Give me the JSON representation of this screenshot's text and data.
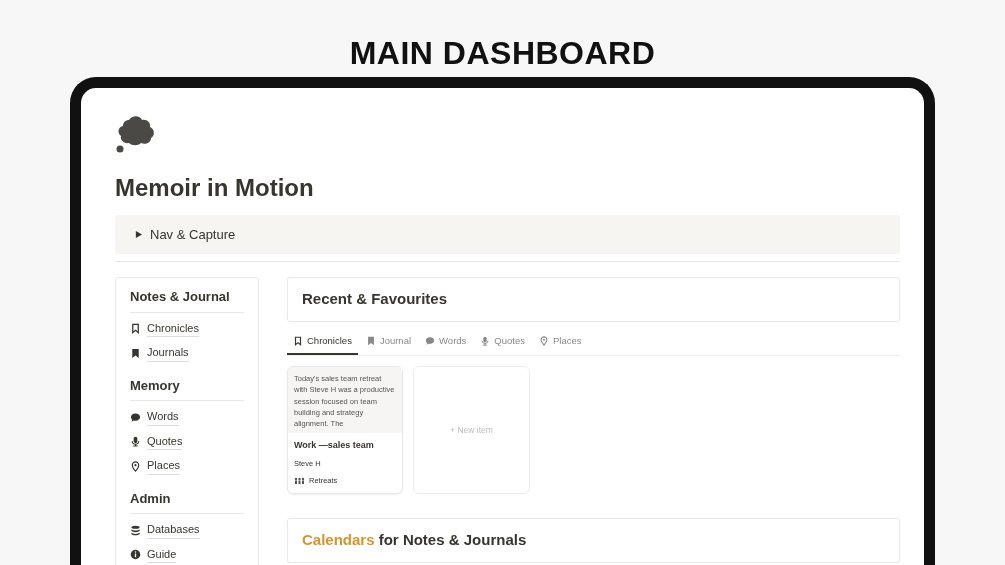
{
  "heading": "MAIN DASHBOARD",
  "page": {
    "title": "Memoir in Motion",
    "toggle": {
      "label": "Nav & Capture",
      "expanded": false
    }
  },
  "sidebar": {
    "sections": [
      {
        "title": "Notes & Journal",
        "items": [
          {
            "label": "Chronicles",
            "kind": "outline"
          },
          {
            "label": "Journals",
            "kind": "bookmark"
          }
        ]
      },
      {
        "title": "Memory",
        "items": [
          {
            "label": "Words",
            "kind": "bubble"
          },
          {
            "label": "Quotes",
            "kind": "mic"
          },
          {
            "label": "Places",
            "kind": "pin"
          }
        ]
      },
      {
        "title": "Admin",
        "items": [
          {
            "label": "Databases",
            "kind": "database"
          },
          {
            "label": "Guide",
            "kind": "info"
          }
        ]
      }
    ]
  },
  "recent": {
    "title": "Recent & Favourites",
    "tabs": [
      {
        "label": "Chronicles",
        "kind": "outline",
        "selected": true
      },
      {
        "label": "Journal",
        "kind": "bookmark",
        "selected": false
      },
      {
        "label": "Words",
        "kind": "bubble",
        "selected": false
      },
      {
        "label": "Quotes",
        "kind": "mic",
        "selected": false
      },
      {
        "label": "Places",
        "kind": "pin",
        "selected": false
      }
    ],
    "cards": [
      {
        "preview": "Today's sales team retreat with Steve H was a productive session focused on team building and strategy alignment. The",
        "title": "Work —sales team",
        "person": "Steve H",
        "tag": "Retreats"
      }
    ],
    "new_item": "+ New item"
  },
  "calendars": {
    "title_highlight": "Calendars",
    "title_rest": "for Notes & Journals"
  }
}
